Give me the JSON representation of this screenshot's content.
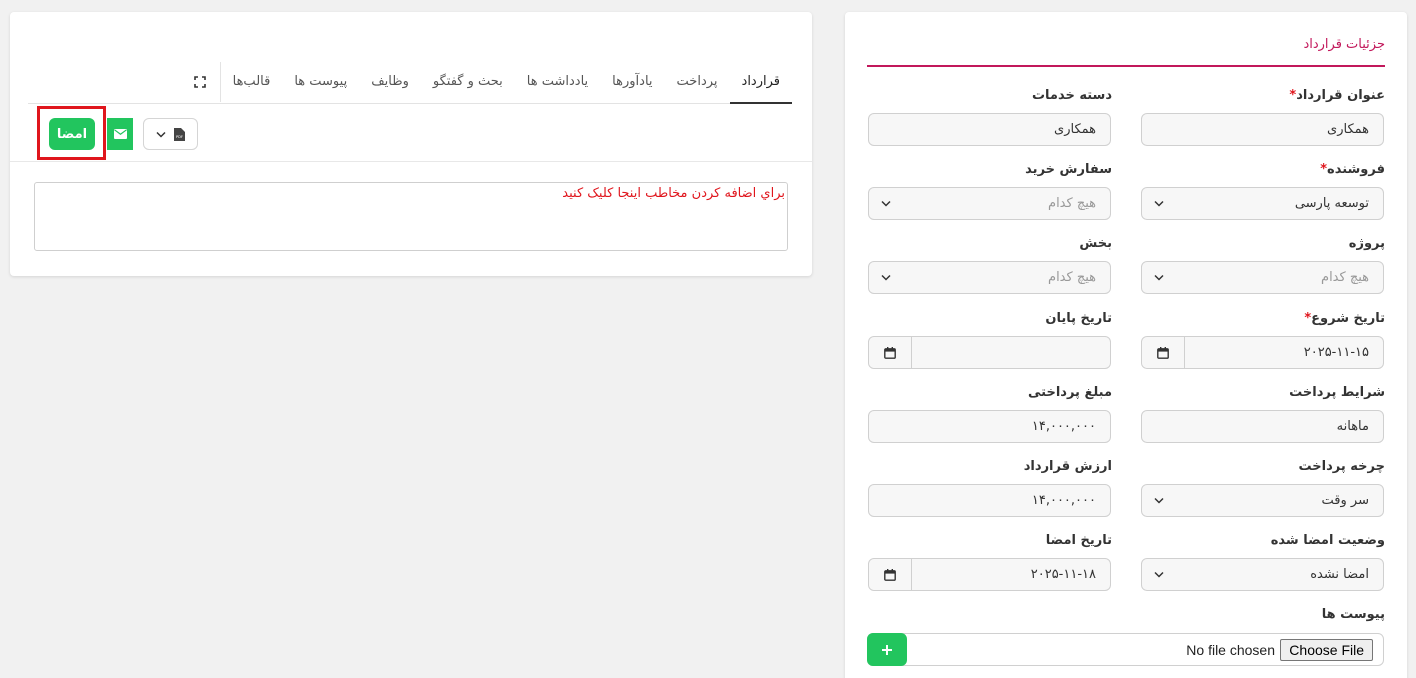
{
  "tabs": [
    {
      "label": "قرارداد",
      "active": true
    },
    {
      "label": "پرداخت"
    },
    {
      "label": "یادآورها"
    },
    {
      "label": "یادداشت ها"
    },
    {
      "label": "بحث و گفتگو"
    },
    {
      "label": "وظایف"
    },
    {
      "label": "پیوست ها"
    },
    {
      "label": "قالب‌ها"
    }
  ],
  "toolbar": {
    "sign_label": "امضا",
    "mail_icon": "envelope-icon",
    "pdf_icon": "pdf-file-icon"
  },
  "contact_placeholder": "براي اضافه کردن مخاطب اينجا کليک کنيد",
  "details": {
    "title": "جزئیات قرارداد",
    "required_mark": "*",
    "contract_title": {
      "label": "عنوان قرارداد",
      "value": "همکاری"
    },
    "service_category": {
      "label": "دسته خدمات",
      "value": "همکاری"
    },
    "seller": {
      "label": "فروشنده",
      "value": "توسعه پارسی"
    },
    "purchase_order": {
      "label": "سفارش خرید",
      "value": "هیچ کدام"
    },
    "project": {
      "label": "پروژه",
      "value": "هیچ کدام"
    },
    "department": {
      "label": "بخش",
      "value": "هیچ کدام"
    },
    "start_date": {
      "label": "تاریخ شروع",
      "value": "۲۰۲۵-۱۱-۱۵"
    },
    "end_date": {
      "label": "تاریخ پایان",
      "value": ""
    },
    "payment_terms": {
      "label": "شرایط پرداخت",
      "value": "ماهانه"
    },
    "payment_amount": {
      "label": "مبلغ پرداختی",
      "value": "۱۴,۰۰۰,۰۰۰"
    },
    "payment_cycle": {
      "label": "چرخه پرداخت",
      "value": "سر وقت"
    },
    "contract_value": {
      "label": "ارزش قرارداد",
      "value": "۱۴,۰۰۰,۰۰۰"
    },
    "sign_status": {
      "label": "وضعیت امضا شده",
      "value": "امضا نشده"
    },
    "sign_date": {
      "label": "تاریخ امضا",
      "value": "۲۰۲۵-۱۱-۱۸"
    },
    "attachments": {
      "label": "پیوست ها",
      "no_file": "No file chosen",
      "choose": "Choose File",
      "add": "+"
    }
  },
  "colors": {
    "accent": "#c2185b",
    "green": "#22c55e",
    "highlight": "#e0161d"
  }
}
